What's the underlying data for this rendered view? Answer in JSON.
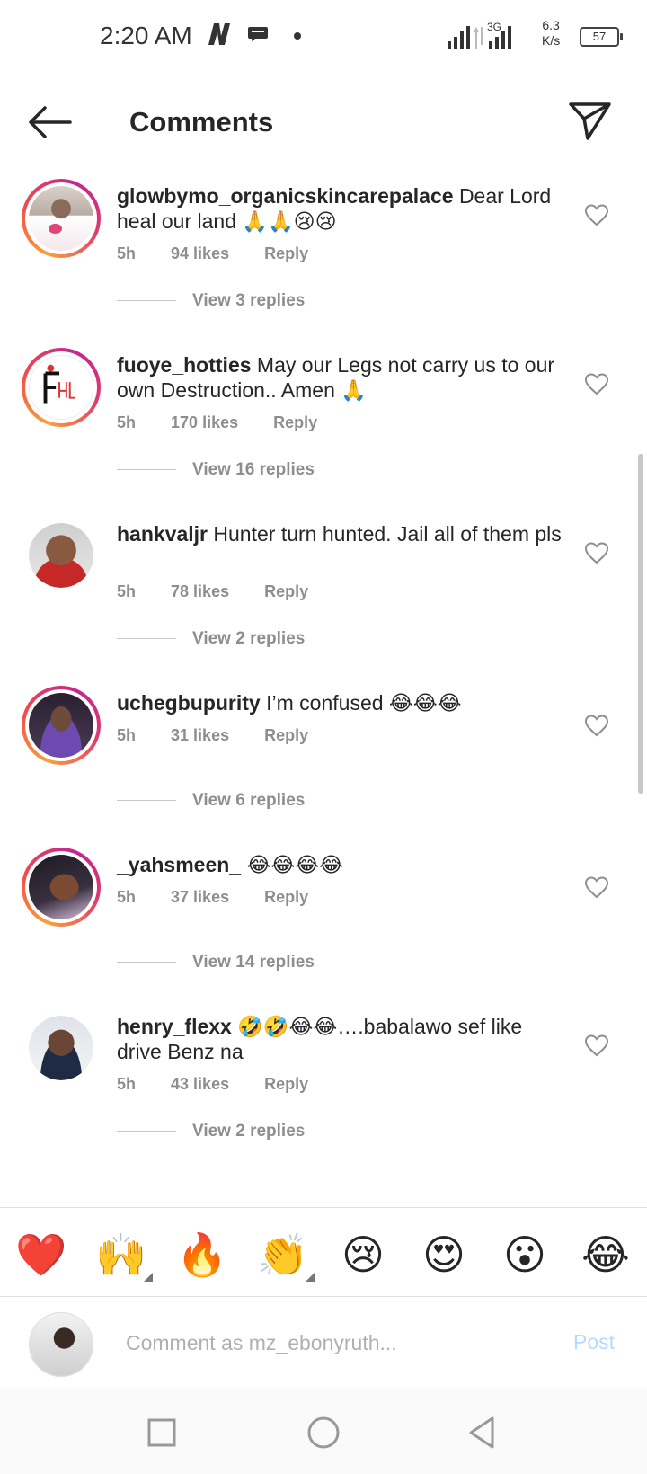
{
  "status_bar": {
    "time": "2:20 AM",
    "network_type": "3G",
    "speed_value": "6.3",
    "speed_unit": "K/s",
    "battery": "57"
  },
  "header": {
    "title": "Comments",
    "back_icon": "arrow-left-icon",
    "share_icon": "paper-plane-icon"
  },
  "comments": [
    {
      "username": "glowbymo_organicskincarepalace",
      "text": "Dear Lord heal our land 🙏🙏😢😢",
      "time": "5h",
      "likes": "94 likes",
      "reply": "Reply",
      "view_replies": "View 3 replies"
    },
    {
      "username": "fuoye_hotties",
      "text": "May our Legs not carry us to our own Destruction.. Amen 🙏",
      "time": "5h",
      "likes": "170 likes",
      "reply": "Reply",
      "view_replies": "View 16 replies"
    },
    {
      "username": "hankvaljr",
      "text": "Hunter turn hunted. Jail all of them pls",
      "time": "5h",
      "likes": "78 likes",
      "reply": "Reply",
      "view_replies": "View 2 replies"
    },
    {
      "username": "uchegbupurity",
      "text": "I’m confused 😂😂😂",
      "time": "5h",
      "likes": "31 likes",
      "reply": "Reply",
      "view_replies": "View 6 replies"
    },
    {
      "username": "_yahsmeen_",
      "text": "😂😂😂😂",
      "time": "5h",
      "likes": "37 likes",
      "reply": "Reply",
      "view_replies": "View 14 replies"
    },
    {
      "username": "henry_flexx",
      "text": "🤣🤣😂😂….babalawo sef like drive Benz na",
      "time": "5h",
      "likes": "43 likes",
      "reply": "Reply",
      "view_replies": "View 2 replies"
    }
  ],
  "emoji_bar": [
    "❤️",
    "🙌",
    "🔥",
    "👏",
    "😢",
    "😍",
    "😮",
    "😂"
  ],
  "comment_input": {
    "placeholder": "Comment as mz_ebonyruth...",
    "post_label": "Post"
  },
  "colors": {
    "text": "#262626",
    "muted": "#8e8e8e",
    "post_disabled": "#b3dbff",
    "story_ring_start": "#f9a13a",
    "story_ring_end": "#c4268f"
  }
}
